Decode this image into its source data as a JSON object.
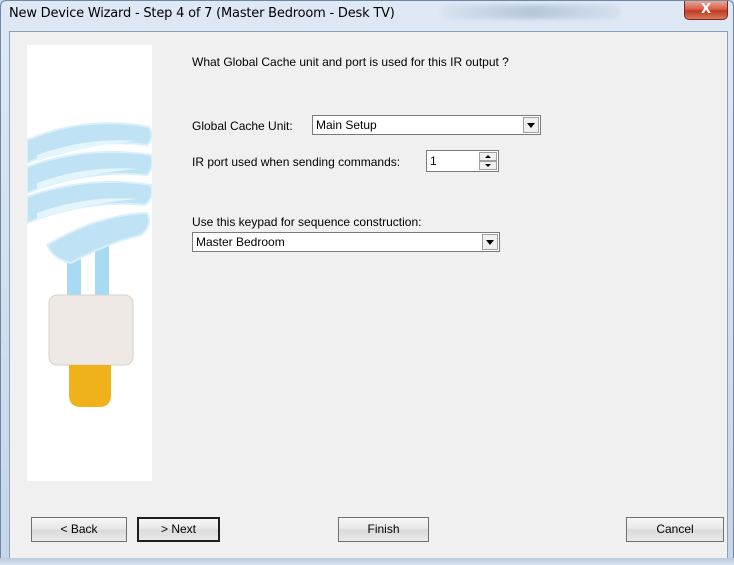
{
  "window": {
    "title": "New Device Wizard - Step 4 of 7 (Master Bedroom - Desk TV)",
    "close_label": "X"
  },
  "wizard": {
    "question": "What Global Cache unit and port is used for this IR output ?",
    "gc_unit_label": "Global Cache Unit:",
    "gc_unit_value": "Main Setup",
    "ir_port_label": "IR port used when sending commands:",
    "ir_port_value": "1",
    "keypad_label": "Use this keypad for sequence construction:",
    "keypad_value": "Master Bedroom"
  },
  "buttons": {
    "back": "< Back",
    "next": "> Next",
    "finish": "Finish",
    "cancel": "Cancel"
  },
  "colors": {
    "bulb_spiral": "#bfe3f5",
    "bulb_base": "#efe9e6",
    "bulb_cap": "#f0b21a"
  }
}
